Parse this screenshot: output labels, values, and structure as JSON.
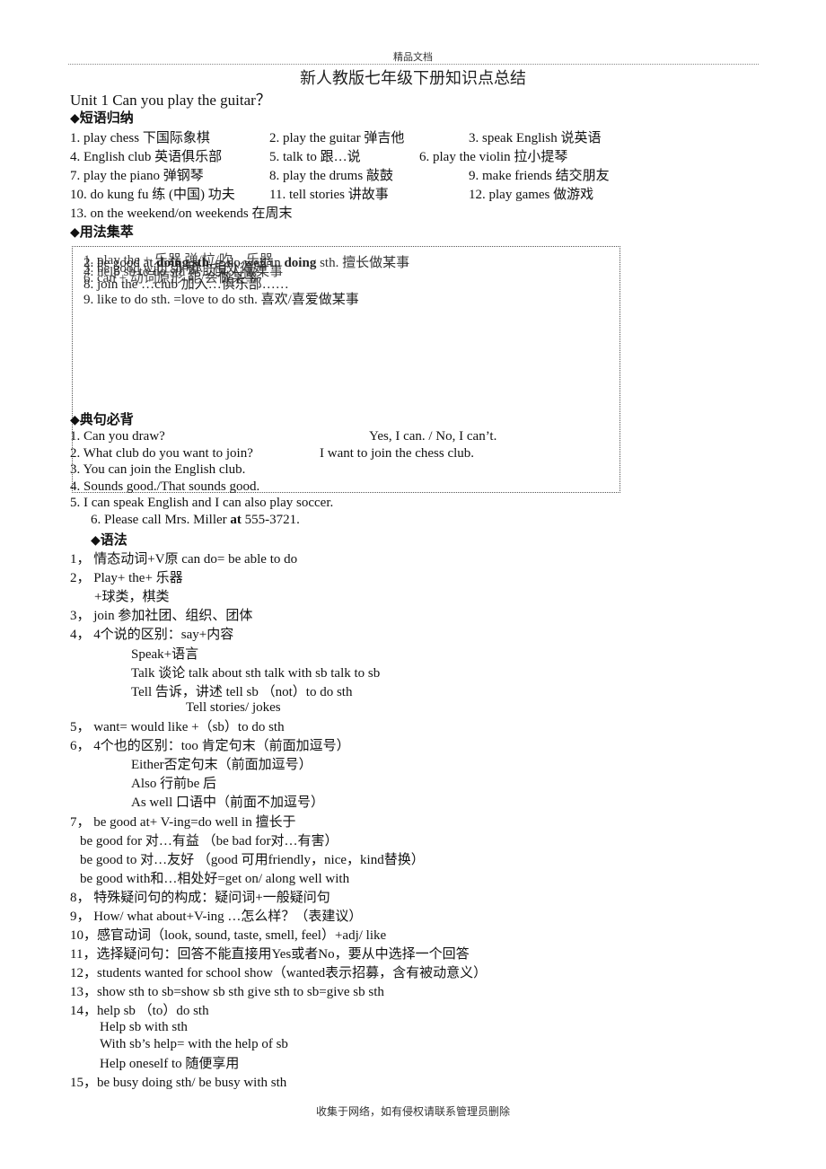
{
  "header": {
    "watermark": "精品文档",
    "title": "新人教版七年级下册知识点总结"
  },
  "unit": {
    "title": "Unit 1 Can you play the guitar？"
  },
  "phrases": {
    "heading": "短语归纳",
    "items": [
      "1. play chess 下国际象棋",
      "2. play the guitar 弹吉他",
      "3. speak English 说英语",
      "4. English club 英语俱乐部",
      "5. talk to 跟…说",
      "6. play the violin 拉小提琴",
      "7. play the piano 弹钢琴",
      "8. play the drums 敲鼓",
      "9. make friends 结交朋友",
      "10. do kung fu 练 (中国) 功夫",
      "11. tell stories 讲故事",
      "12. play games 做游戏",
      "13. on the weekend/on weekends  在周末"
    ]
  },
  "usage": {
    "heading": "用法集萃",
    "overlapped_lines": [
      "1. play the + 乐器  弹/拉/吹…乐器",
      "2. be good at ",
      "doing sth.",
      " = do well in ",
      "doing",
      " sth. 擅长做某事",
      "3. be good with sb 和…相处得好",
      "4. help sb to do sth 帮助某人做某事",
      "6. can + 动词原形 能/会做某事",
      "8. join the …club 加入…俱乐部……"
    ],
    "line9": "9. like to do sth. =love to do sth.  喜欢/喜爱做某事"
  },
  "sentences": {
    "heading": "典句必背",
    "items": [
      {
        "q": "1. Can you draw?",
        "a": "Yes, I can. / No, I can’t."
      },
      {
        "q": "2. What club do you want to join?",
        "a": "I want to join the chess club."
      },
      {
        "q": "3. You can join the English club.",
        "a": ""
      },
      {
        "q": "4. Sounds good./That sounds good.",
        "a": ""
      },
      {
        "q": "5. I can speak English and I can also play soccer.",
        "a": ""
      }
    ],
    "item6_pre": "6. Please call Mrs. Miller ",
    "item6_bold": "at",
    "item6_post": " 555-3721."
  },
  "grammar": {
    "heading": "语法",
    "lines": [
      "1， 情态动词+V原  can do= be able to do",
      "2， Play+ the+ 乐器",
      "+球类，棋类",
      "3， join 参加社团、组织、团体",
      "4， 4个说的区别：say+内容",
      "Speak+语言",
      "Talk 谈论 talk about sth   talk with sb   talk to sb",
      "Tell 告诉，讲述 tell sb （not）to do sth",
      "Tell stories/ jokes",
      "5， want= would like +（sb）to do sth",
      "6， 4个也的区别：too 肯定句末（前面加逗号）",
      "Either否定句末（前面加逗号）",
      "Also 行前be 后",
      "As well 口语中（前面不加逗号）",
      "7， be good at+ V-ing=do well in 擅长于",
      "be good for 对…有益 （be bad for对…有害）",
      "be good to 对…友好 （good 可用friendly，nice，kind替换）",
      "be good with和…相处好=get on/ along well with",
      "8， 特殊疑问句的构成：疑问词+一般疑问句",
      "9， How/ what about+V-ing   …怎么样？（表建议）",
      "10，感官动词（look, sound, taste, smell, feel）+adj/ like",
      "11，选择疑问句：回答不能直接用Yes或者No，要从中选择一个回答",
      "12，students wanted for school show（wanted表示招募，含有被动意义）",
      "13，show sth to sb=show sb sth     give sth to sb=give sb sth",
      "14，help sb （to）do sth",
      "Help sb with sth",
      "With sb’s help= with the help of sb",
      "Help oneself to 随便享用",
      "15，be busy doing sth/ be busy with sth"
    ]
  },
  "footer": {
    "text": "收集于网络，如有侵权请联系管理员删除"
  },
  "icons": {
    "section_bullet": "◆"
  }
}
